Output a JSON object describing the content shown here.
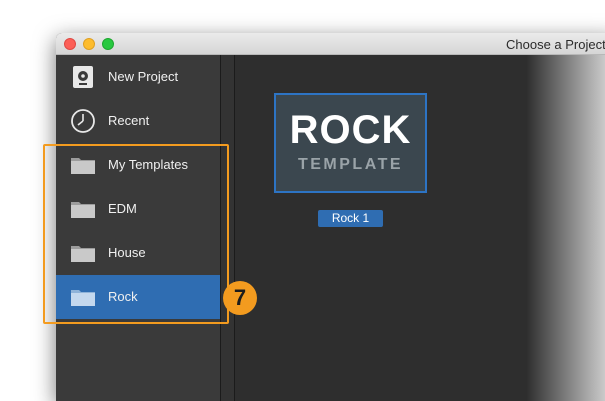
{
  "window": {
    "title": "Choose a Project"
  },
  "sidebar": {
    "items": [
      {
        "label": "New Project",
        "icon": "new-project-icon",
        "selected": false
      },
      {
        "label": "Recent",
        "icon": "clock-icon",
        "selected": false
      },
      {
        "label": "My Templates",
        "icon": "folder-icon",
        "selected": false
      },
      {
        "label": "EDM",
        "icon": "folder-icon",
        "selected": false
      },
      {
        "label": "House",
        "icon": "folder-icon",
        "selected": false
      },
      {
        "label": "Rock",
        "icon": "folder-icon",
        "selected": true
      }
    ]
  },
  "main": {
    "template_card": {
      "title": "ROCK",
      "subtitle": "TEMPLATE",
      "name": "Rock 1"
    }
  },
  "annotation": {
    "badge_number": "7",
    "color": "#f39b1f"
  },
  "colors": {
    "selection": "#2f6db2",
    "sidebar_bg": "#3a3a3a",
    "main_bg": "#2e2e2e"
  }
}
